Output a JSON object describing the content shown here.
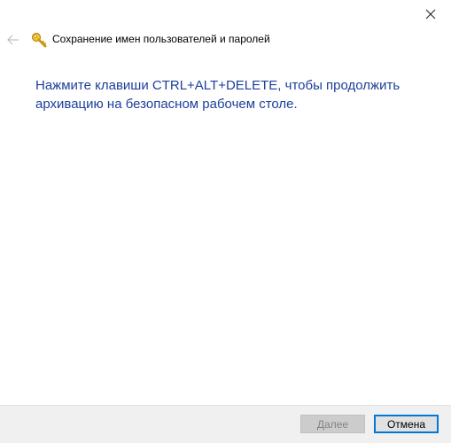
{
  "window": {
    "title": "Сохранение имен пользователей и паролей"
  },
  "icons": {
    "close": "close-icon",
    "back": "back-arrow-icon",
    "key": "key-icon"
  },
  "main": {
    "instruction": "Нажмите клавиши CTRL+ALT+DELETE, чтобы продолжить архивацию на безопасном рабочем столе."
  },
  "footer": {
    "next_label": "Далее",
    "next_enabled": false,
    "cancel_label": "Отмена"
  },
  "colors": {
    "instruction_text": "#1e3f9a",
    "focus_border": "#0078d7",
    "footer_bg": "#f0f0f0"
  }
}
